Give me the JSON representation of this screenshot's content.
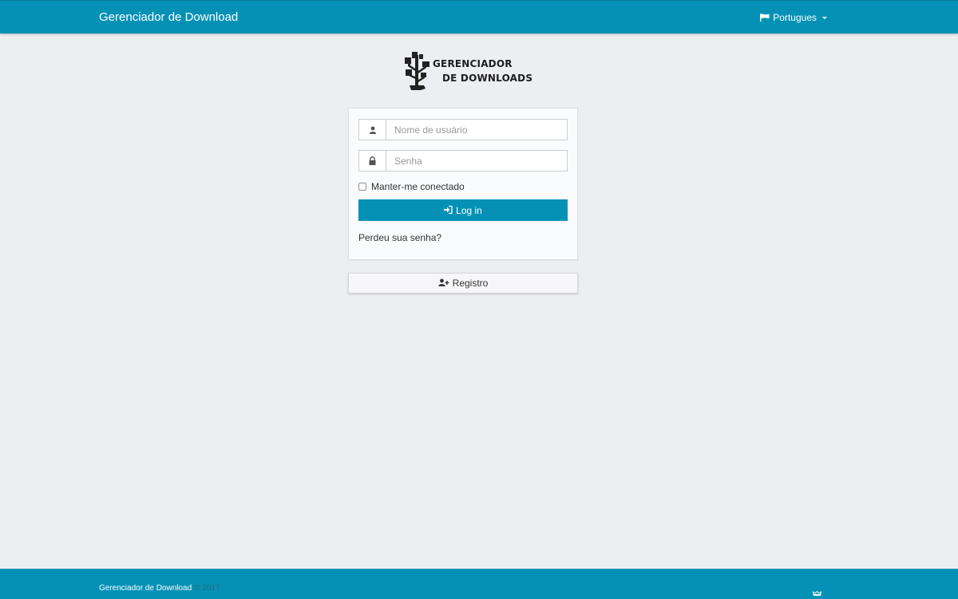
{
  "navbar": {
    "brand": "Gerenciador de Download",
    "language": "Portugues"
  },
  "logo": {
    "line1": "GERENCIADOR",
    "line2": "DE DOWNLOADS"
  },
  "login": {
    "username_placeholder": "Nome de usuário",
    "password_placeholder": "Senha",
    "remember_label": "Manter-me conectado",
    "login_button": "Log in",
    "forgot_link": "Perdeu sua senha?"
  },
  "register": {
    "label": "Registro"
  },
  "footer": {
    "brand": "Gerenciador de Download",
    "copyright": "© 2017"
  },
  "colors": {
    "primary": "#0591b6",
    "background": "#edeef2"
  }
}
